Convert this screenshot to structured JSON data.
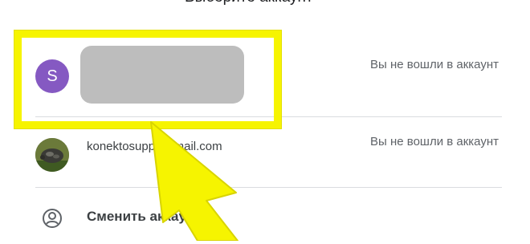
{
  "header": {
    "title": "Выберите аккаунт"
  },
  "accounts": [
    {
      "avatar_letter": "S",
      "avatar_color": "#8559c2",
      "status": "Вы не вошли в аккаунт"
    },
    {
      "email": "konektosupp@gmail.com",
      "status": "Вы не вошли в аккаунт"
    }
  ],
  "switch_account": {
    "label": "Сменить аккаунт",
    "icon": "account-circle-icon"
  },
  "annotation": {
    "highlight_color": "#f6f400",
    "arrow_color": "#f6f400"
  }
}
